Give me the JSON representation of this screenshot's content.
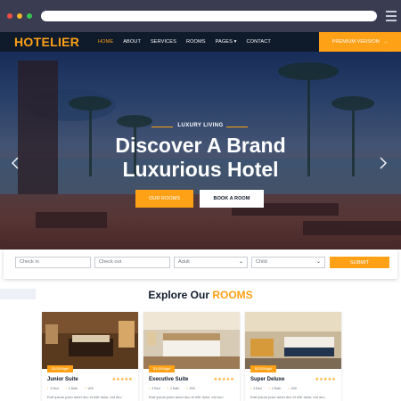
{
  "browser": {
    "dots": [
      "red-dot",
      "yellow-dot",
      "green-dot"
    ]
  },
  "brand": {
    "name": "HOTELIER",
    "color": "#FEA116",
    "dark": "#0F1A2B"
  },
  "nav": {
    "items": [
      {
        "label": "HOME",
        "active": true
      },
      {
        "label": "ABOUT"
      },
      {
        "label": "SERVICES"
      },
      {
        "label": "ROOMS"
      },
      {
        "label": "PAGES"
      },
      {
        "label": "CONTACT"
      }
    ],
    "premium_label": "PREMIUM VERSION"
  },
  "hero": {
    "subtitle": "LUXURY LIVING",
    "title_line1": "Discover A Brand",
    "title_line2": "Luxurious Hotel",
    "btn_rooms": "OUR ROOMS",
    "btn_book": "BOOK A ROOM"
  },
  "booking": {
    "check_in": "Check in",
    "check_out": "Check out",
    "adult": "Adult",
    "child": "Child",
    "submit": "SUBMIT"
  },
  "rooms": {
    "title_prefix": "Explore Our",
    "title_accent": "ROOMS",
    "cards": [
      {
        "name": "Junior Suite",
        "price": "$100/Night",
        "stars": "★★★★★",
        "bed": "3 Bed",
        "bath": "2 Bath",
        "wifi": "Wifi",
        "text": "Erat ipsum justo amet duo et elitr dolor, est duo"
      },
      {
        "name": "Executive Suite",
        "price": "$100/Night",
        "stars": "★★★★★",
        "bed": "3 Bed",
        "bath": "2 Bath",
        "wifi": "Wifi",
        "text": "Erat ipsum justo amet duo et elitr dolor, est duo"
      },
      {
        "name": "Super Deluxe",
        "price": "$100/Night",
        "stars": "★★★★★",
        "bed": "3 Bed",
        "bath": "2 Bath",
        "wifi": "Wifi",
        "text": "Erat ipsum justo amet duo et elitr dolor, est duo"
      }
    ]
  }
}
